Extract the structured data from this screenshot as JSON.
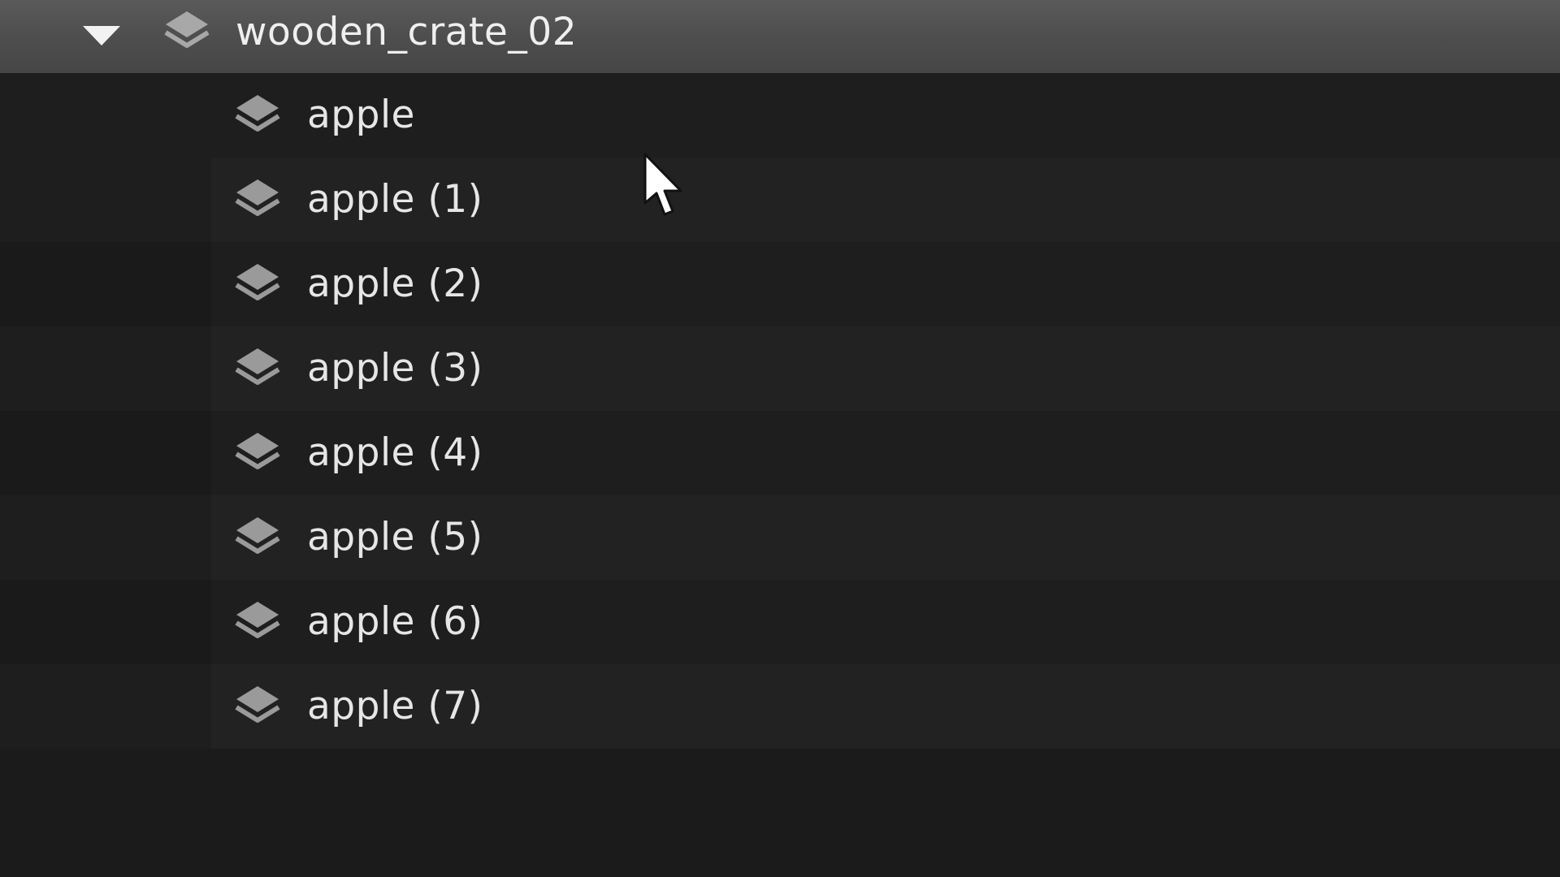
{
  "outliner": {
    "parent": {
      "label": "wooden_crate_02",
      "expanded": true,
      "icon": "layer-stack-icon",
      "expander_icon": "triangle-down-icon"
    },
    "children": [
      {
        "label": "apple",
        "icon": "layer-stack-icon"
      },
      {
        "label": "apple (1)",
        "icon": "layer-stack-icon"
      },
      {
        "label": "apple (2)",
        "icon": "layer-stack-icon"
      },
      {
        "label": "apple (3)",
        "icon": "layer-stack-icon"
      },
      {
        "label": "apple (4)",
        "icon": "layer-stack-icon"
      },
      {
        "label": "apple (5)",
        "icon": "layer-stack-icon"
      },
      {
        "label": "apple (6)",
        "icon": "layer-stack-icon"
      },
      {
        "label": "apple (7)",
        "icon": "layer-stack-icon"
      }
    ]
  },
  "colors": {
    "background": "#1b1b1c",
    "parent_row": "#4d4d4e",
    "text": "#e6e6e6",
    "icon": "#9a9a9a"
  },
  "cursor": {
    "icon": "mouse-pointer-icon"
  }
}
